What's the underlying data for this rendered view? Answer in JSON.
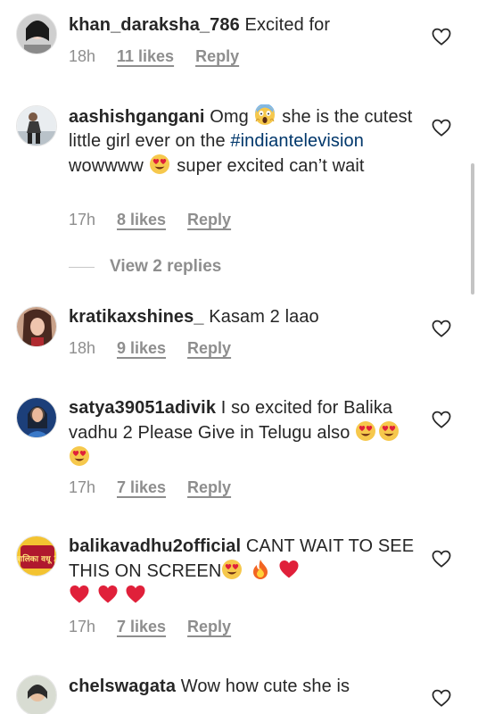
{
  "comments": [
    {
      "user": "khan_daraksha_786",
      "text": "Excited for",
      "time": "18h",
      "likes": "11 likes",
      "reply": "Reply"
    },
    {
      "user": "aashishgangani",
      "text_a": "Omg",
      "text_b": "she is the cutest little girl ever on the",
      "hashtag": "#indiantelevision",
      "text_c": "wowwww",
      "text_d": "super excited can’t wait",
      "time": "17h",
      "likes": "8 likes",
      "reply": "Reply"
    },
    {
      "user": "kratikaxshines_",
      "text": "Kasam 2 laao",
      "time": "18h",
      "likes": "9 likes",
      "reply": "Reply"
    },
    {
      "user": "satya39051adivik",
      "text": "I so excited for Balika vadhu 2 Please Give in Telugu also",
      "time": "17h",
      "likes": "7 likes",
      "reply": "Reply"
    },
    {
      "user": "balikavadhu2official",
      "text": "CANT WAIT TO SEE THIS ON SCREEN",
      "time": "17h",
      "likes": "7 likes",
      "reply": "Reply"
    },
    {
      "user": "chelswagata",
      "text": "Wow how cute she is"
    }
  ],
  "view_replies": "View 2 replies",
  "avatar_badge": "बालिका वधू 2",
  "icons": {
    "like": "heart-outline-icon"
  }
}
